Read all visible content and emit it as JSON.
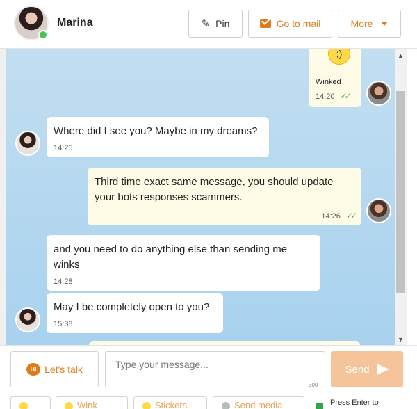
{
  "header": {
    "name": "Marina",
    "pin_label": "Pin",
    "mail_label": "Go to mail",
    "more_label": "More"
  },
  "messages": [
    {
      "direction": "out",
      "text": "Winked",
      "time": "14:20",
      "read": true
    },
    {
      "direction": "in",
      "text": "Where did I see you? Maybe in my dreams?",
      "time": "14:25"
    },
    {
      "direction": "out",
      "text": "Third time exact same message, you should update your bots responses scammers.",
      "time": "14:26",
      "read": true
    },
    {
      "direction": "in",
      "text": "and you need to do anything else than sending me winks",
      "time": "14:28"
    },
    {
      "direction": "in",
      "text": "May I be completely open to you?",
      "time": "15:38"
    }
  ],
  "composer": {
    "lets_talk_label": "Let's talk",
    "hi_badge": "HI",
    "placeholder": "Type your message...",
    "char_limit": "300",
    "send_label": "Send",
    "toolbar": [
      {
        "label": ""
      },
      {
        "label": "Wink"
      },
      {
        "label": "Stickers"
      },
      {
        "label": "Send media"
      }
    ],
    "press_enter_label": "Press Enter to",
    "press_enter_checked": true
  },
  "colors": {
    "accent": "#e07b1a",
    "online": "#46c35b",
    "read_check": "#43b04f",
    "chat_bg": "#b7d9f0",
    "outgoing_bubble": "#fefbe6"
  }
}
